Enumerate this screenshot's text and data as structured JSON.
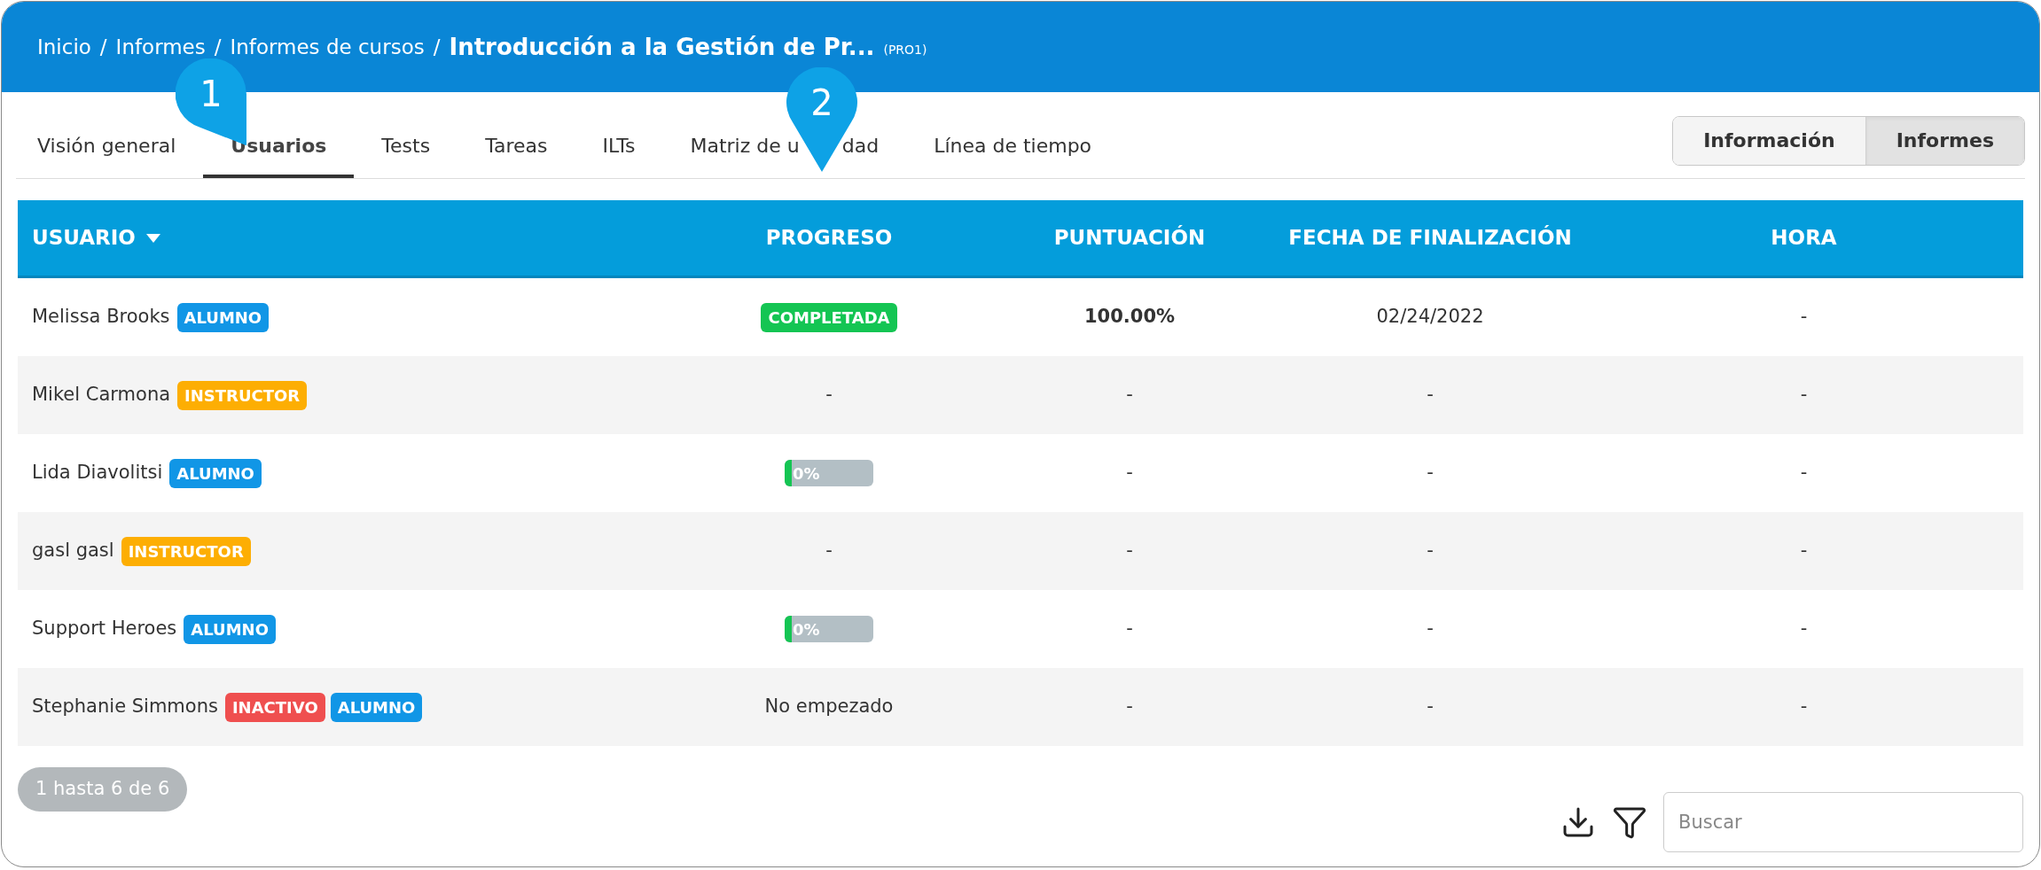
{
  "breadcrumb": {
    "separator": "/",
    "items": [
      "Inicio",
      "Informes",
      "Informes de cursos"
    ],
    "title": "Introducción a la Gestión de Pr...",
    "code": "(PRO1)"
  },
  "tabs": [
    {
      "label": "Visión general",
      "selected": false
    },
    {
      "label": "Usuarios",
      "selected": true
    },
    {
      "label": "Tests",
      "selected": false
    },
    {
      "label": "Tareas",
      "selected": false
    },
    {
      "label": "ILTs",
      "selected": false
    },
    {
      "label": "Matriz de u",
      "label_tail": "dad",
      "selected": false
    },
    {
      "label": "Línea de tiempo",
      "selected": false
    }
  ],
  "view_toggle": [
    {
      "label": "Información",
      "selected": false
    },
    {
      "label": "Informes",
      "selected": true
    }
  ],
  "callouts": [
    {
      "label": "1",
      "kind": "tilted"
    },
    {
      "label": "2",
      "kind": "upright"
    }
  ],
  "table": {
    "columns": [
      {
        "label": "USUARIO",
        "sorted": true
      },
      {
        "label": "PROGRESO",
        "sorted": false
      },
      {
        "label": "PUNTUACIÓN",
        "sorted": false
      },
      {
        "label": "FECHA DE FINALIZACIÓN",
        "sorted": false
      },
      {
        "label": "HORA",
        "sorted": false
      }
    ],
    "rows": [
      {
        "user": "Melissa Brooks",
        "badges": [
          {
            "label": "ALUMNO",
            "color": "#1196e6"
          }
        ],
        "progress": {
          "kind": "badge",
          "text": "COMPLETADA"
        },
        "score": "100.00%",
        "date": "02/24/2022",
        "time": "-"
      },
      {
        "user": "Mikel Carmona",
        "badges": [
          {
            "label": "INSTRUCTOR",
            "color": "#fdae03"
          }
        ],
        "progress": {
          "kind": "text",
          "text": "-"
        },
        "score": "-",
        "date": "-",
        "time": "-"
      },
      {
        "user": "Lida Diavolitsi",
        "badges": [
          {
            "label": "ALUMNO",
            "color": "#1196e6"
          }
        ],
        "progress": {
          "kind": "bar",
          "text": "0%",
          "level": 0.08
        },
        "score": "-",
        "date": "-",
        "time": "-"
      },
      {
        "user": "gasl gasl",
        "badges": [
          {
            "label": "INSTRUCTOR",
            "color": "#fdae03"
          }
        ],
        "progress": {
          "kind": "text",
          "text": "-"
        },
        "score": "-",
        "date": "-",
        "time": "-"
      },
      {
        "user": "Support Heroes",
        "badges": [
          {
            "label": "ALUMNO",
            "color": "#1196e6"
          }
        ],
        "progress": {
          "kind": "bar",
          "text": "0%",
          "level": 0.08
        },
        "score": "-",
        "date": "-",
        "time": "-"
      },
      {
        "user": "Stephanie Simmons",
        "badges": [
          {
            "label": "INACTIVO",
            "color": "#ef4f4f"
          },
          {
            "label": "ALUMNO",
            "color": "#1196e6"
          }
        ],
        "progress": {
          "kind": "text",
          "text": "No empezado"
        },
        "score": "-",
        "date": "-",
        "time": "-"
      }
    ]
  },
  "footer": {
    "pagination": "1 hasta 6 de 6",
    "search": {
      "placeholder": "Buscar"
    }
  }
}
